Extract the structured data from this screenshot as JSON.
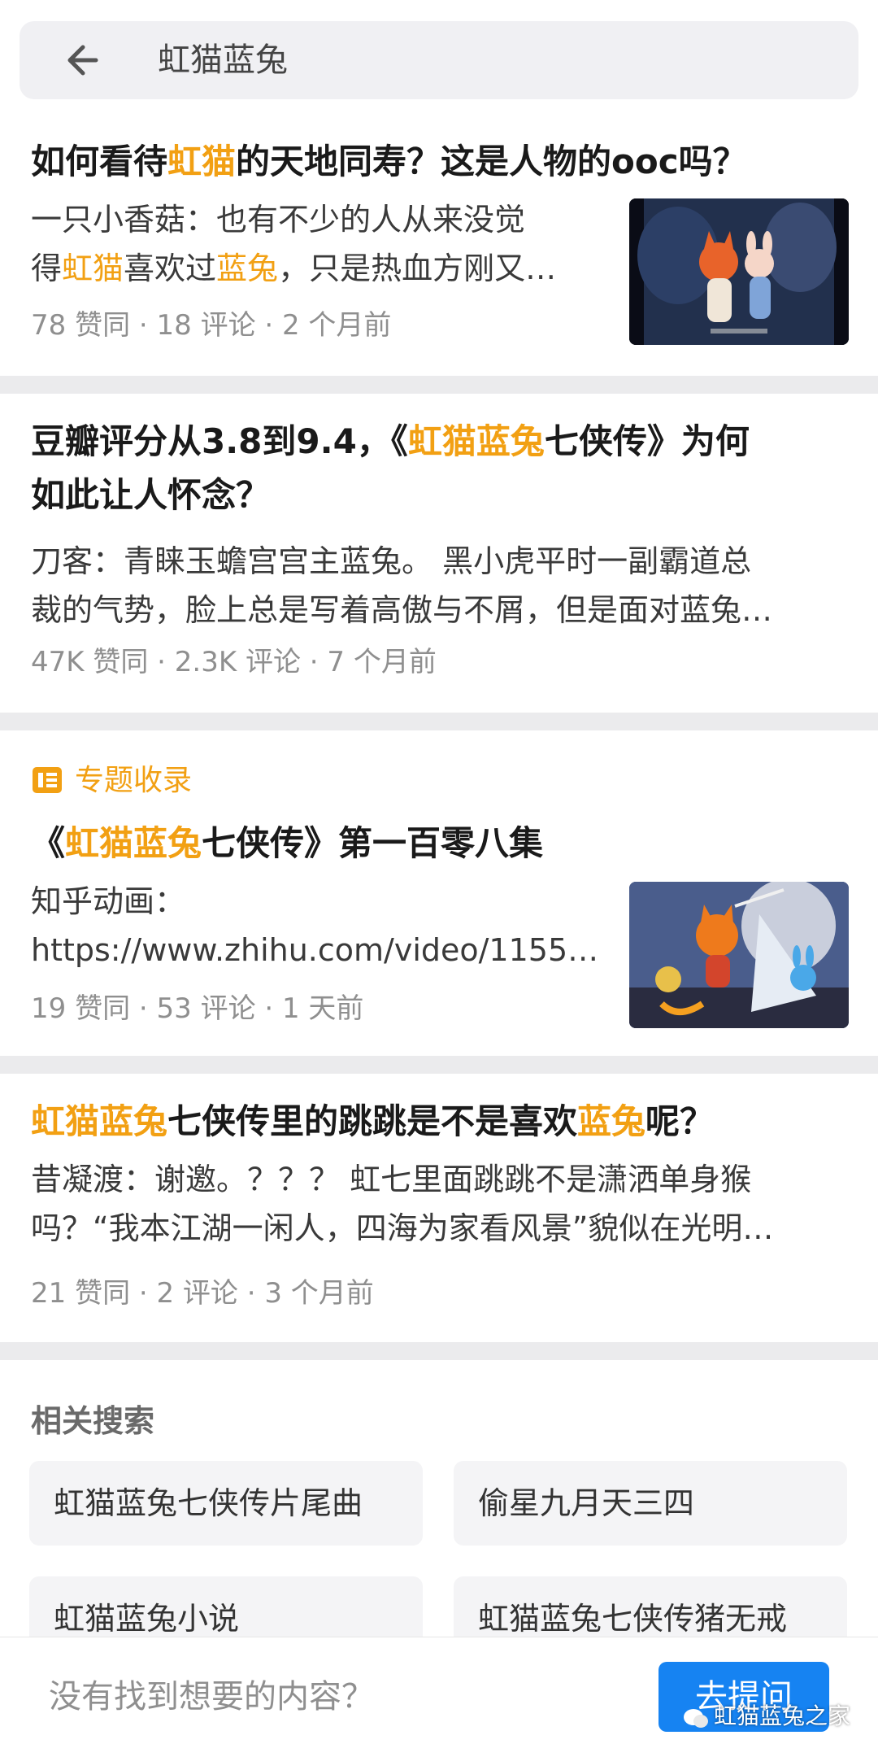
{
  "search": {
    "query": "虹猫蓝兔"
  },
  "results": [
    {
      "title": [
        "如何看待",
        "虹猫",
        "的天地同寿？这是人物的ooc吗？"
      ],
      "excerpt_line1": "一只小香菇：也有不少的人从来没觉",
      "excerpt_line2": [
        "得",
        "虹猫",
        "喜欢过",
        "蓝兔",
        "，只是热血方刚又…"
      ],
      "meta": "78 赞同 · 18 评论 · 2 个月前"
    },
    {
      "title_line1": [
        "豆瓣评分从3.8到9.4，《",
        "虹猫蓝兔",
        "七侠传》为何"
      ],
      "title_line2": "如此让人怀念？",
      "excerpt_line1": "刀客：青睐玉蟾宫宫主蓝兔。 黑小虎平时一副霸道总",
      "excerpt_line2": "裁的气势，脸上总是写着高傲与不屑，但是面对蓝兔…",
      "meta": "47K 赞同 · 2.3K 评论 · 7 个月前"
    },
    {
      "tag": "专题收录",
      "title": [
        "《",
        "虹猫蓝兔",
        "七侠传》第一百零八集"
      ],
      "excerpt_line1": "知乎动画：",
      "excerpt_line2": "https://www.zhihu.com/video/1155…",
      "meta": "19 赞同 · 53 评论 · 1 天前"
    },
    {
      "title": [
        "虹猫蓝兔",
        "七侠传里的跳跳是不是喜欢",
        "蓝兔",
        "呢？"
      ],
      "excerpt_line1": "昔凝渡：谢邀。？？？ 虹七里面跳跳不是潇洒单身猴",
      "excerpt_line2": "吗？“我本江湖一闲人，四海为家看风景”貌似在光明…",
      "meta": "21 赞同 · 2 评论 · 3 个月前"
    }
  ],
  "related": {
    "title": "相关搜索",
    "items": [
      "虹猫蓝兔七侠传片尾曲",
      "偷星九月天三四",
      "虹猫蓝兔小说",
      "虹猫蓝兔七侠传猪无戒"
    ]
  },
  "footer": {
    "prompt": "没有找到想要的内容？",
    "ask_label": "去提问"
  },
  "watermark": "虹猫蓝兔之家",
  "colors": {
    "highlight": "#f2a013",
    "accent": "#1683f2",
    "meta": "#8f8f8f"
  }
}
